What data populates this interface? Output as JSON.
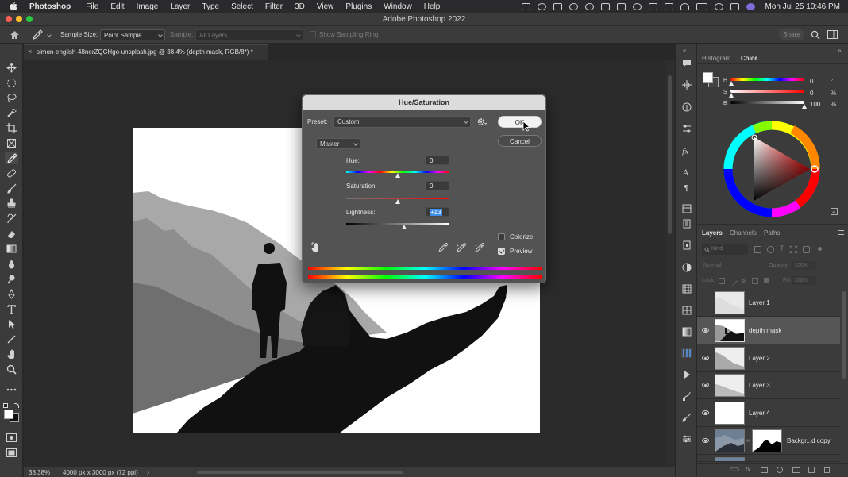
{
  "menubar": {
    "app": "Photoshop",
    "items": [
      "File",
      "Edit",
      "Image",
      "Layer",
      "Type",
      "Select",
      "Filter",
      "3D",
      "View",
      "Plugins",
      "Window",
      "Help"
    ],
    "datetime": "Mon Jul 25  10:46 PM"
  },
  "window": {
    "title": "Adobe Photoshop 2022"
  },
  "options": {
    "sample_size_label": "Sample Size:",
    "sample_size_value": "Point Sample",
    "sample_label": "Sample:",
    "sample_value": "All Layers",
    "show_ring_label": "Show Sampling Ring",
    "share_label": "Share"
  },
  "document": {
    "tab_title": "simon-english-48nerZQCHgo-unsplash.jpg @ 38.4% (depth mask, RGB/8*) *",
    "zoom": "38.38%",
    "size": "4000 px x 3000 px (72 ppi)"
  },
  "dialog": {
    "title": "Hue/Saturation",
    "preset_label": "Preset:",
    "preset_value": "Custom",
    "channel": "Master",
    "hue_label": "Hue:",
    "hue_value": "0",
    "saturation_label": "Saturation:",
    "saturation_value": "0",
    "lightness_label": "Lightness:",
    "lightness_value": "+13",
    "ok_label": "OK",
    "cancel_label": "Cancel",
    "colorize_label": "Colorize",
    "preview_label": "Preview"
  },
  "color_panel": {
    "tabs": [
      "Histogram",
      "Color"
    ],
    "h_label": "H",
    "h_value": "0",
    "h_unit": "°",
    "s_label": "S",
    "s_value": "0",
    "s_unit": "%",
    "b_label": "B",
    "b_value": "100",
    "b_unit": "%"
  },
  "layers_panel": {
    "tabs": [
      "Layers",
      "Channels",
      "Paths"
    ],
    "kind_placeholder": "Kind",
    "blend_mode": "Normal",
    "opacity_label": "Opacity:",
    "opacity_value": "100%",
    "lock_label": "Lock:",
    "fill_label": "Fill:",
    "fill_value": "100%",
    "layers": [
      {
        "name": "Layer 1"
      },
      {
        "name": "depth mask"
      },
      {
        "name": "Layer 2"
      },
      {
        "name": "Layer 3"
      },
      {
        "name": "Layer 4"
      },
      {
        "name": "Backgr...d copy"
      }
    ]
  },
  "colors": {
    "accent": "#2f6fd6",
    "selection": "#3e8de8"
  }
}
